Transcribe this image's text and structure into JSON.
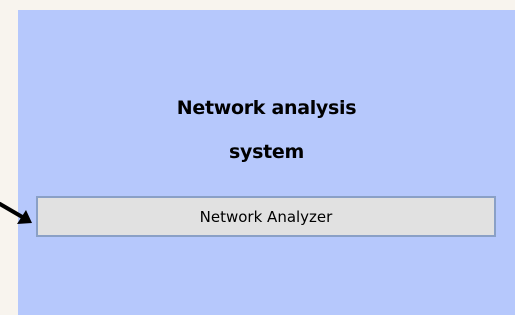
{
  "panel": {
    "title_line1": "Network analysis",
    "title_line2": "system",
    "button_label": "Network Analyzer"
  },
  "colors": {
    "panel_bg": "#b6c8fc",
    "button_bg": "#e1e1e1",
    "button_border": "#8aa0c6",
    "page_bg": "#f8f4ee"
  },
  "icons": {
    "pointer": "arrow-pointer-icon"
  }
}
